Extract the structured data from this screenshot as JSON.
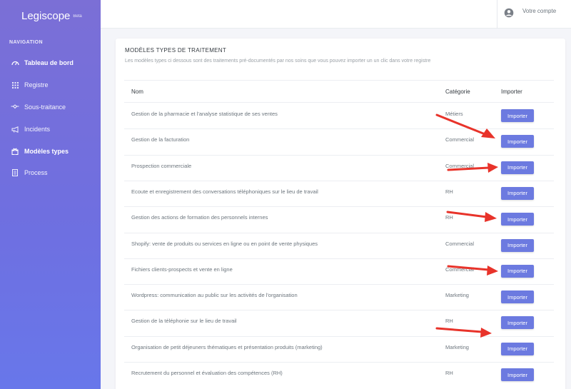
{
  "sidebar": {
    "brand": "Legiscope",
    "brand_tag": "Beta",
    "nav_title": "NAVIGATION",
    "items": [
      {
        "label": "Tableau de bord",
        "icon": "dashboard-icon"
      },
      {
        "label": "Registre",
        "icon": "grid-icon"
      },
      {
        "label": "Sous-traitance",
        "icon": "handshake-icon"
      },
      {
        "label": "Incidents",
        "icon": "megaphone-icon"
      },
      {
        "label": "Modèles types",
        "icon": "gift-icon"
      },
      {
        "label": "Process",
        "icon": "document-icon"
      }
    ],
    "active_item": "Modèles types"
  },
  "header": {
    "account_label": "Votre compte",
    "account_icon": "user-circle-icon"
  },
  "card": {
    "title": "MODÈLES TYPES DE TRAITEMENT",
    "subtitle": "Les modèles types ci dessous sont des traitements pré-documentés par nos soins que vous pouvez importer un un clic dans votre registre"
  },
  "table": {
    "headers": {
      "name": "Nom",
      "category": "Catégorie",
      "import": "Importer"
    },
    "button_label": "Importer",
    "rows": [
      {
        "name": "Gestion de la pharmacie et l'analyse statistique de ses ventes",
        "category": "Métiers"
      },
      {
        "name": "Gestion de la facturation",
        "category": "Commercial"
      },
      {
        "name": "Prospection commerciale",
        "category": "Commercial"
      },
      {
        "name": "Ecoute et enregistrement des conversations téléphoniques sur le lieu de travail",
        "category": "RH"
      },
      {
        "name": "Gestion des actions de formation des personnels internes",
        "category": "RH"
      },
      {
        "name": "Shopify: vente de produits ou services en ligne ou en point de vente physiques",
        "category": "Commercial"
      },
      {
        "name": "Fichiers clients-prospects et vente en ligne",
        "category": "Commercial"
      },
      {
        "name": "Wordpress: communication au public sur les activités de l'organisation",
        "category": "Marketing"
      },
      {
        "name": "Gestion de la téléphonie sur le lieu de travail",
        "category": "RH"
      },
      {
        "name": "Organisation de petit déjeuners thématiques et présentation produits (marketing)",
        "category": "Marketing"
      },
      {
        "name": "Recrutement du personnel et évaluation des compétences (RH)",
        "category": "RH"
      }
    ]
  },
  "colors": {
    "accent": "#6c7ae0",
    "arrow": "#e8332a"
  }
}
